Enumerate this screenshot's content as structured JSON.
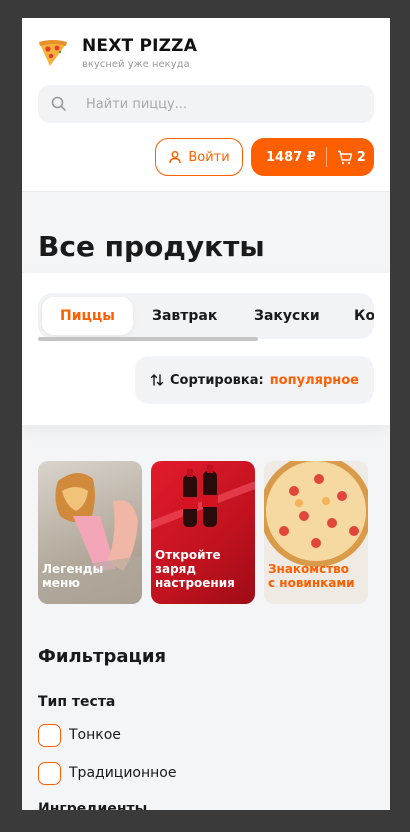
{
  "header": {
    "brand_title": "NEXT PIZZA",
    "brand_subtitle": "вкусней уже некуда",
    "search_placeholder": "Найти пиццу...",
    "login_label": "Войти",
    "cart_price": "1487 ₽",
    "cart_count": "2"
  },
  "page_title": "Все продукты",
  "categories": {
    "tabs": [
      "Пиццы",
      "Завтрак",
      "Закуски",
      "Коктейли"
    ],
    "active": "Пиццы"
  },
  "sort": {
    "label": "Сортировка:",
    "value": "популярное"
  },
  "stories": [
    {
      "label": "Легенды\nменю",
      "color": "#ffffff"
    },
    {
      "label": "Откройте\nзаряд\nнастроения",
      "color": "#ffffff"
    },
    {
      "label": "Знакомство\nс новинками",
      "color": "#fe5f00"
    }
  ],
  "filters": {
    "title": "Фильтрация",
    "dough_group": "Тип теста",
    "dough_options": [
      "Тонкое",
      "Традиционное"
    ],
    "next_group": "Ингредиенты"
  },
  "colors": {
    "accent": "#fe5f00",
    "background": "#f4f5f7"
  }
}
